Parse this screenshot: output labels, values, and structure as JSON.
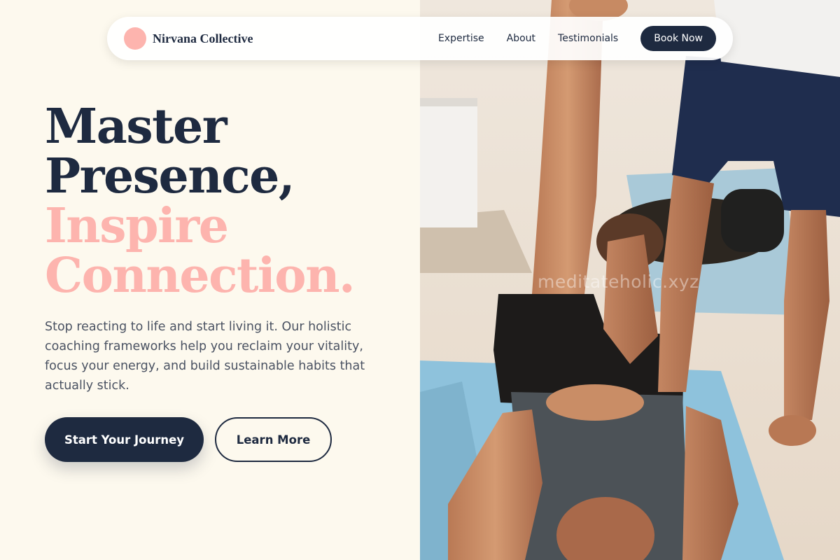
{
  "nav": {
    "brand": "Nirvana Collective",
    "links": [
      "Expertise",
      "About",
      "Testimonials"
    ],
    "cta": "Book Now"
  },
  "hero": {
    "title_lines": [
      "Master",
      "Presence,",
      "Inspire",
      "Connection."
    ],
    "subtitle": "Stop reacting to life and start living it. Our holistic coaching frameworks help you reclaim your vitality, focus your energy, and build sustainable habits that actually stick.",
    "primary_button": "Start Your Journey",
    "secondary_button": "Learn More"
  },
  "photo": {
    "watermark": "meditateholic.xyz"
  },
  "colors": {
    "background": "#fdf9ee",
    "navy": "#1e2a40",
    "accent_pink": "#fdb4ae",
    "body_text": "#4a5262"
  }
}
